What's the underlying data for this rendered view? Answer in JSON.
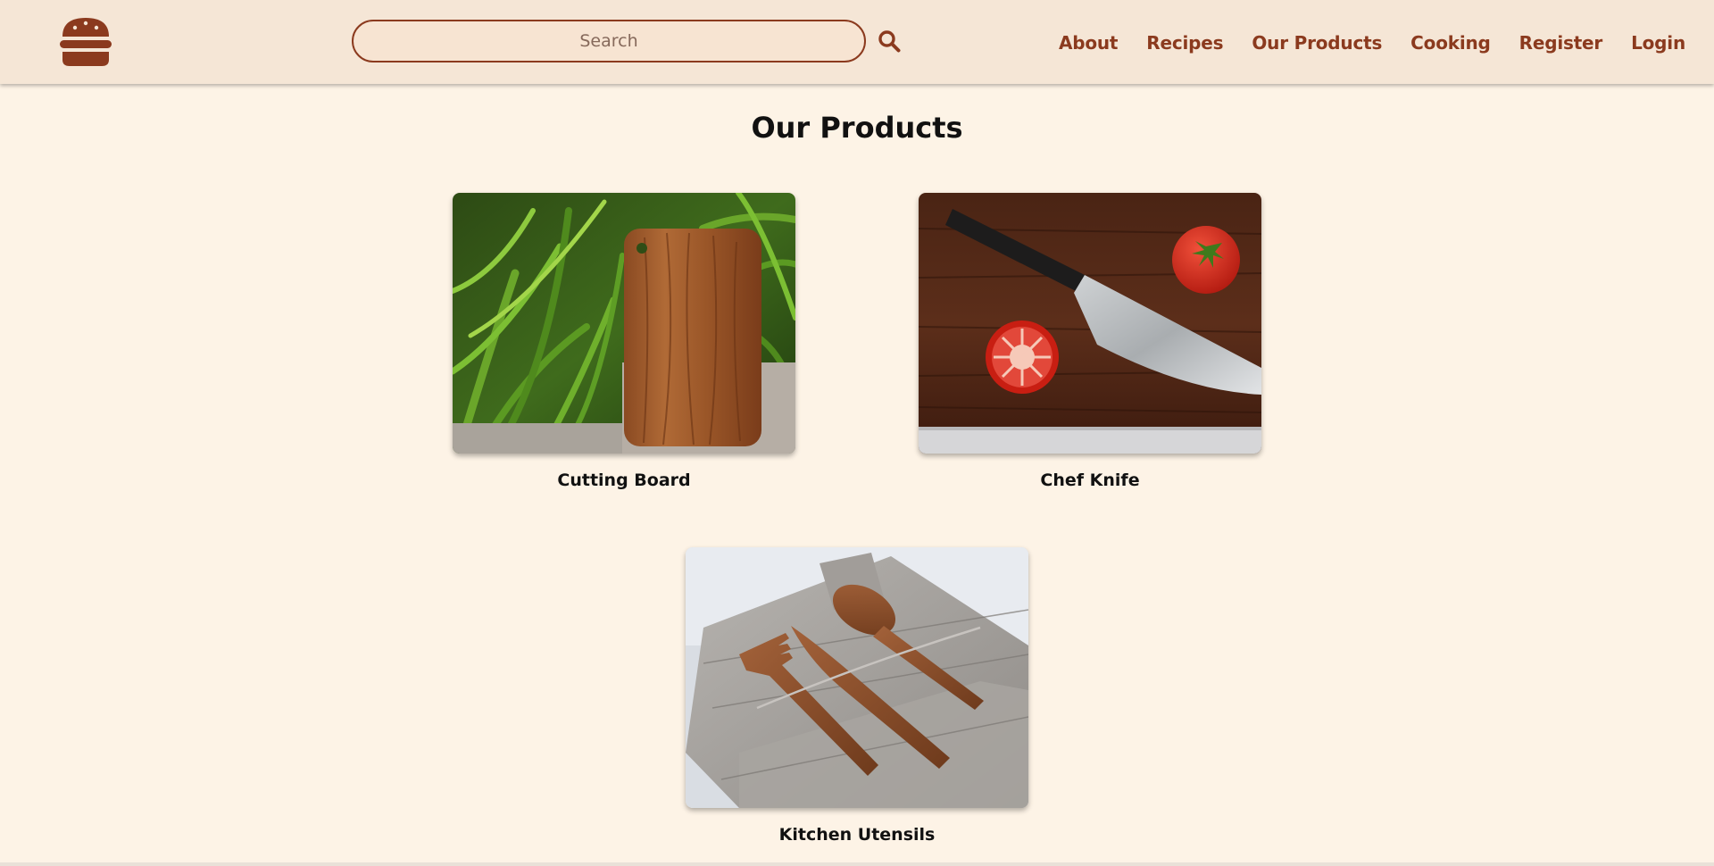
{
  "header": {
    "logo_icon": "hamburger-logo-icon",
    "search": {
      "placeholder": "Search",
      "value": "",
      "button_icon": "search-icon"
    },
    "nav": [
      {
        "label": "About"
      },
      {
        "label": "Recipes"
      },
      {
        "label": "Our Products"
      },
      {
        "label": "Cooking"
      },
      {
        "label": "Register"
      },
      {
        "label": "Login"
      }
    ]
  },
  "main": {
    "title": "Our Products",
    "products": [
      {
        "name": "Cutting Board",
        "image_icon": "cutting-board-photo"
      },
      {
        "name": "Chef Knife",
        "image_icon": "chef-knife-photo"
      },
      {
        "name": "Kitchen Utensils",
        "image_icon": "kitchen-utensils-photo"
      }
    ]
  },
  "colors": {
    "page_background": "#fdf3e6",
    "header_background": "#f5e6d6",
    "accent_brown": "#8b3a1e",
    "search_background": "#f7e4d2",
    "title_text": "#111111"
  }
}
